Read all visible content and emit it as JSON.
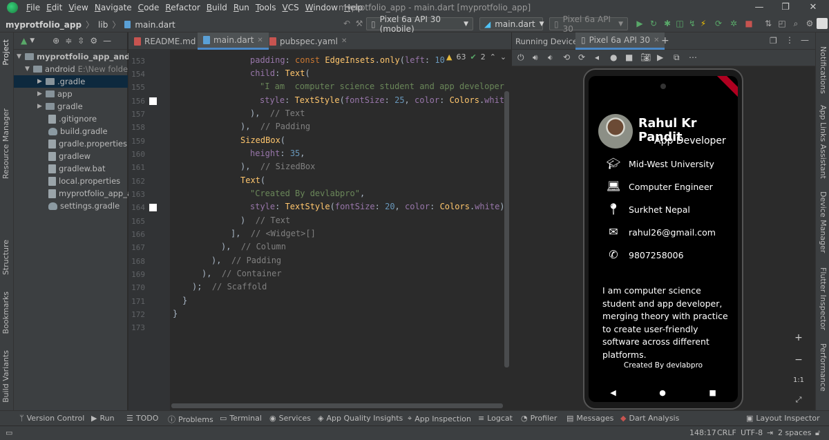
{
  "window": {
    "menus": [
      "File",
      "Edit",
      "View",
      "Navigate",
      "Code",
      "Refactor",
      "Build",
      "Run",
      "Tools",
      "VCS",
      "Window",
      "Help"
    ],
    "title": "myprotfolio_app - main.dart [myprotfolio_app]"
  },
  "toolbar": {
    "breadcrumb": [
      "myprotfolio_app",
      "lib",
      "main.dart"
    ],
    "device_selector": "Pixel 6a API 30 (mobile)",
    "run_config": "main.dart",
    "emulator": "Pixel 6a API 30"
  },
  "left_strip": [
    "Project",
    "Resource Manager",
    "Structure",
    "Bookmarks",
    "Build Variants"
  ],
  "right_strip": [
    "Notifications",
    "App Links Assistant",
    "Device Manager",
    "Flutter Inspector",
    "Flutter Performance"
  ],
  "project": {
    "root": "myprotfolio_app_android",
    "android_label": "android",
    "android_path": "E:\\New folder\\m",
    "items": [
      ".gradle",
      "app",
      "gradle",
      ".gitignore",
      "build.gradle",
      "gradle.properties",
      "gradlew",
      "gradlew.bat",
      "local.properties",
      "myprotfolio_app_and",
      "settings.gradle"
    ]
  },
  "editor": {
    "tabs": [
      "README.md",
      "main.dart",
      "pubspec.yaml"
    ],
    "inspection": {
      "warnings": "63",
      "weak": "2"
    },
    "line_numbers": [
      "153",
      "154",
      "155",
      "156",
      "157",
      "158",
      "159",
      "160",
      "161",
      "162",
      "163",
      "164",
      "165",
      "166",
      "167",
      "168",
      "169",
      "170",
      "171",
      "172",
      "173"
    ]
  },
  "running_devices": {
    "label": "Running Devices:",
    "tab": "Pixel 6a API 30"
  },
  "phone": {
    "name": "Rahul Kr Pandit",
    "role": "App Developer",
    "info": [
      {
        "icon": "school-icon",
        "text": "Mid-West University"
      },
      {
        "icon": "laptop-icon",
        "text": "Computer Engineer"
      },
      {
        "icon": "location-icon",
        "text": "Surkhet Nepal"
      },
      {
        "icon": "email-icon",
        "text": "rahul26@gmail.com"
      },
      {
        "icon": "phone-icon",
        "text": "9807258006"
      }
    ],
    "bio": "I am  computer science student and app developer, merging theory with practice to create user-friendly software across different platforms.",
    "credit": "Created By devlabpro"
  },
  "zoom": {
    "plus": "+",
    "minus": "−",
    "one_to_one": "1:1"
  },
  "bottom_tools": [
    "Version Control",
    "Run",
    "TODO",
    "Problems",
    "Terminal",
    "Services",
    "App Quality Insights",
    "App Inspection",
    "Logcat",
    "Profiler",
    "Messages",
    "Dart Analysis",
    "Layout Inspector"
  ],
  "status": {
    "position": "148:17",
    "line_sep": "CRLF",
    "encoding": "UTF-8",
    "indent": "2 spaces"
  },
  "colors": {
    "accent": "#4a88c7",
    "keyword": "#cc7832",
    "string": "#6a8759",
    "class": "#ffc66d",
    "number": "#6897bb"
  }
}
